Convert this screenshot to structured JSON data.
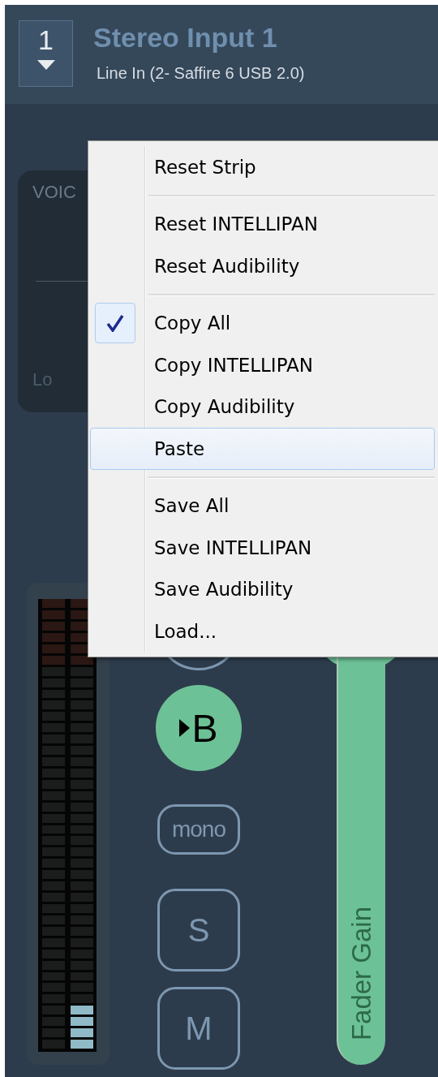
{
  "strip": {
    "number": "1",
    "title": "Stereo Input 1",
    "input": "Line In (2- Saffire 6 USB 2.0)"
  },
  "voice_panel": {
    "label": "VOIC",
    "low_label": "Lo"
  },
  "buttons": [
    {
      "kind": "circle",
      "on": false
    },
    {
      "kind": "circle",
      "label": "B",
      "on": true,
      "arrow": true
    },
    {
      "kind": "pill",
      "label": "mono",
      "on": false
    },
    {
      "kind": "square",
      "label": "S",
      "on": false
    },
    {
      "kind": "square",
      "label": "M",
      "on": false
    }
  ],
  "fader": {
    "label": "Fader Gain",
    "level": 0.67
  },
  "context_menu": {
    "groups": [
      [
        {
          "label": "Reset Strip",
          "checked": false,
          "selected": false
        }
      ],
      [
        {
          "label": "Reset INTELLIPAN",
          "checked": false,
          "selected": false
        },
        {
          "label": "Reset Audibility",
          "checked": false,
          "selected": false
        }
      ],
      [
        {
          "label": "Copy All",
          "checked": true,
          "selected": false
        },
        {
          "label": "Copy INTELLIPAN",
          "checked": false,
          "selected": false
        },
        {
          "label": "Copy Audibility",
          "checked": false,
          "selected": false
        },
        {
          "label": "Paste",
          "checked": false,
          "selected": true
        }
      ],
      [
        {
          "label": "Save All",
          "checked": false,
          "selected": false
        },
        {
          "label": "Save INTELLIPAN",
          "checked": false,
          "selected": false
        },
        {
          "label": "Save Audibility",
          "checked": false,
          "selected": false
        },
        {
          "label": "Load...",
          "checked": false,
          "selected": false
        }
      ]
    ]
  }
}
